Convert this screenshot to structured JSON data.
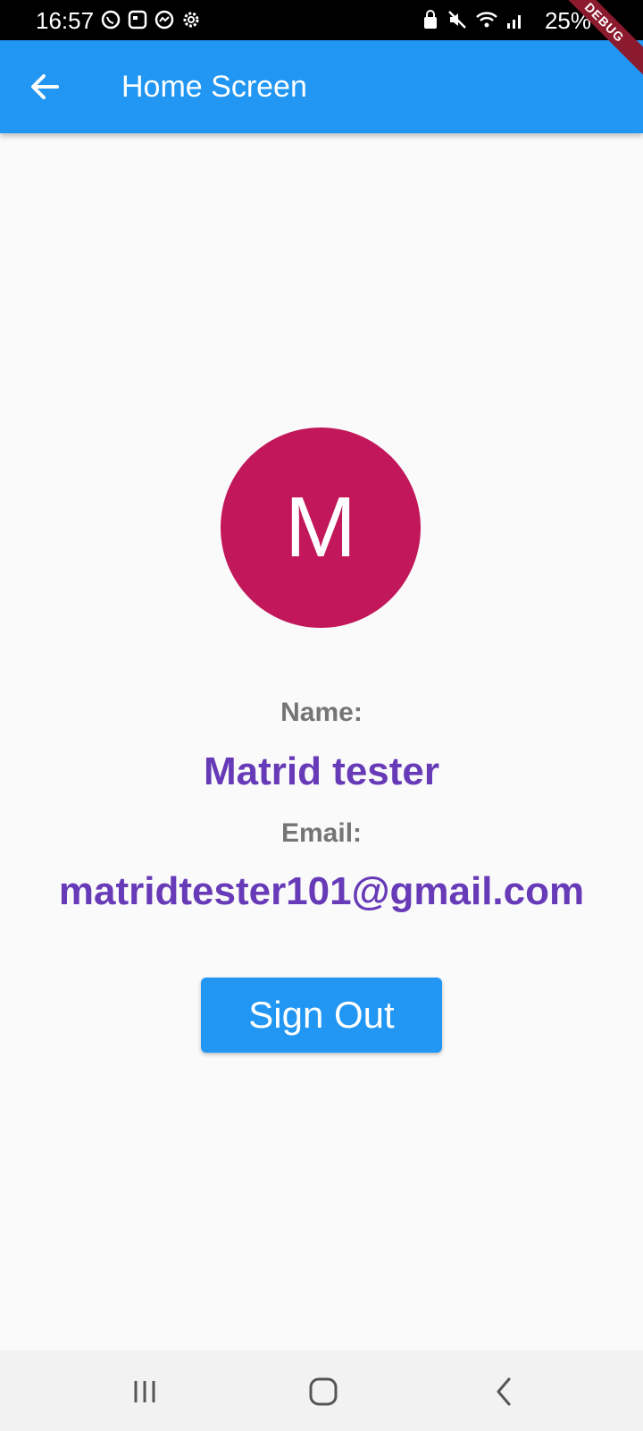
{
  "status_bar": {
    "time": "16:57",
    "left_icons": [
      "whatsapp-icon",
      "news-icon",
      "messenger-icon",
      "settings-icon"
    ],
    "right_icons": [
      "lock-icon",
      "mute-icon",
      "wifi-icon",
      "signal-icon"
    ],
    "battery": "25%"
  },
  "debug_banner": "DEBUG",
  "app_bar": {
    "title": "Home Screen",
    "back_icon": "arrow-back-icon",
    "color": "#2196f3"
  },
  "profile": {
    "avatar_letter": "M",
    "avatar_color": "#c2185b",
    "name_label": "Name:",
    "name_value": "Matrid tester",
    "email_label": "Email:",
    "email_value": "matridtester101@gmail.com"
  },
  "sign_out_label": "Sign Out",
  "nav_bar": {
    "icons": [
      "recent-apps-icon",
      "home-icon",
      "back-icon"
    ]
  }
}
